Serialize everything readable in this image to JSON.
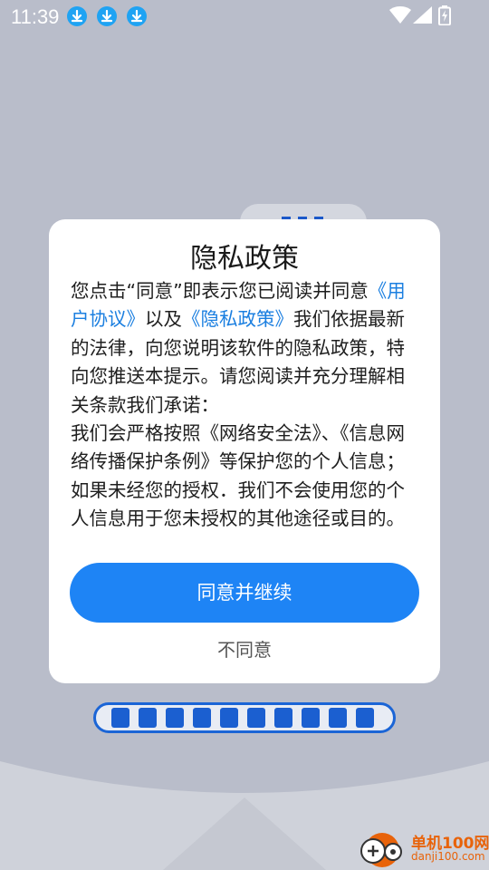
{
  "status_bar": {
    "time": "11:39",
    "icons": [
      "download-icon",
      "download-icon",
      "download-icon",
      "wifi-icon",
      "signal-icon",
      "battery-charging-icon"
    ]
  },
  "dialog": {
    "title": "隐私政策",
    "body": {
      "intro_1": "您点击“同意”即表示您已阅读并同意",
      "link_user_agreement": "《用户协议》",
      "intro_2": "以及",
      "link_privacy_policy": "《隐私政策》",
      "intro_3": "我们依据最新的法律，向您说明该软件的隐私政策，特向您推送本提示。请您阅读并充分理解相关条款我们承诺：",
      "paragraph_2": "我们会严格按照《网络安全法》、《信息网络传播保护条例》等保护您的个人信息；如果未经您的授权．我们不会使用您的个人信息用于您未授权的其他途径或目的。"
    },
    "agree_label": "同意并继续",
    "disagree_label": "不同意"
  },
  "watermark": {
    "name": "单机100网",
    "domain": "danji100.com"
  },
  "colors": {
    "background": "#b9bdca",
    "accent": "#1e84f5",
    "link": "#1b7fe0",
    "progress": "#1b5fd0",
    "download_badge": "#1fa3f3",
    "watermark": "#e8630a"
  }
}
